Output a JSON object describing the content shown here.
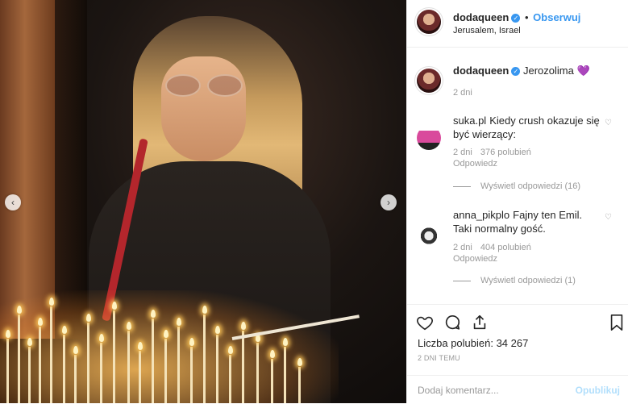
{
  "post": {
    "username": "dodaqueen",
    "follow_label": "Obserwuj",
    "location": "Jerusalem, Israel",
    "caption": "Jerozolima",
    "caption_emoji": "💜",
    "caption_time": "2 dni",
    "likes_label": "Liczba polubień: 34 267",
    "time_ago": "2 DNI TEMU",
    "comment_placeholder": "Dodaj komentarz...",
    "publish_label": "Opublikuj"
  },
  "comments": [
    {
      "username": "suka.pl",
      "text": "Kiedy crush okazuje się być wierzący:",
      "time": "2 dni",
      "likes": "376 polubień",
      "reply": "Odpowiedz",
      "view_replies": "Wyświetl odpowiedzi (16)"
    },
    {
      "username": "anna_pikplo",
      "text": "Fajny ten Emil. Taki normalny gość.",
      "time": "2 dni",
      "likes": "404 polubień",
      "reply": "Odpowiedz",
      "view_replies": "Wyświetl odpowiedzi (1)"
    }
  ],
  "icons": {
    "like": "heart-icon",
    "comment": "comment-icon",
    "share": "share-icon",
    "save": "bookmark-icon",
    "verified": "verified-badge-icon",
    "prev": "chevron-left-icon",
    "next": "chevron-right-icon"
  },
  "colors": {
    "accent": "#3897f0",
    "muted": "#999999",
    "text": "#262626"
  }
}
